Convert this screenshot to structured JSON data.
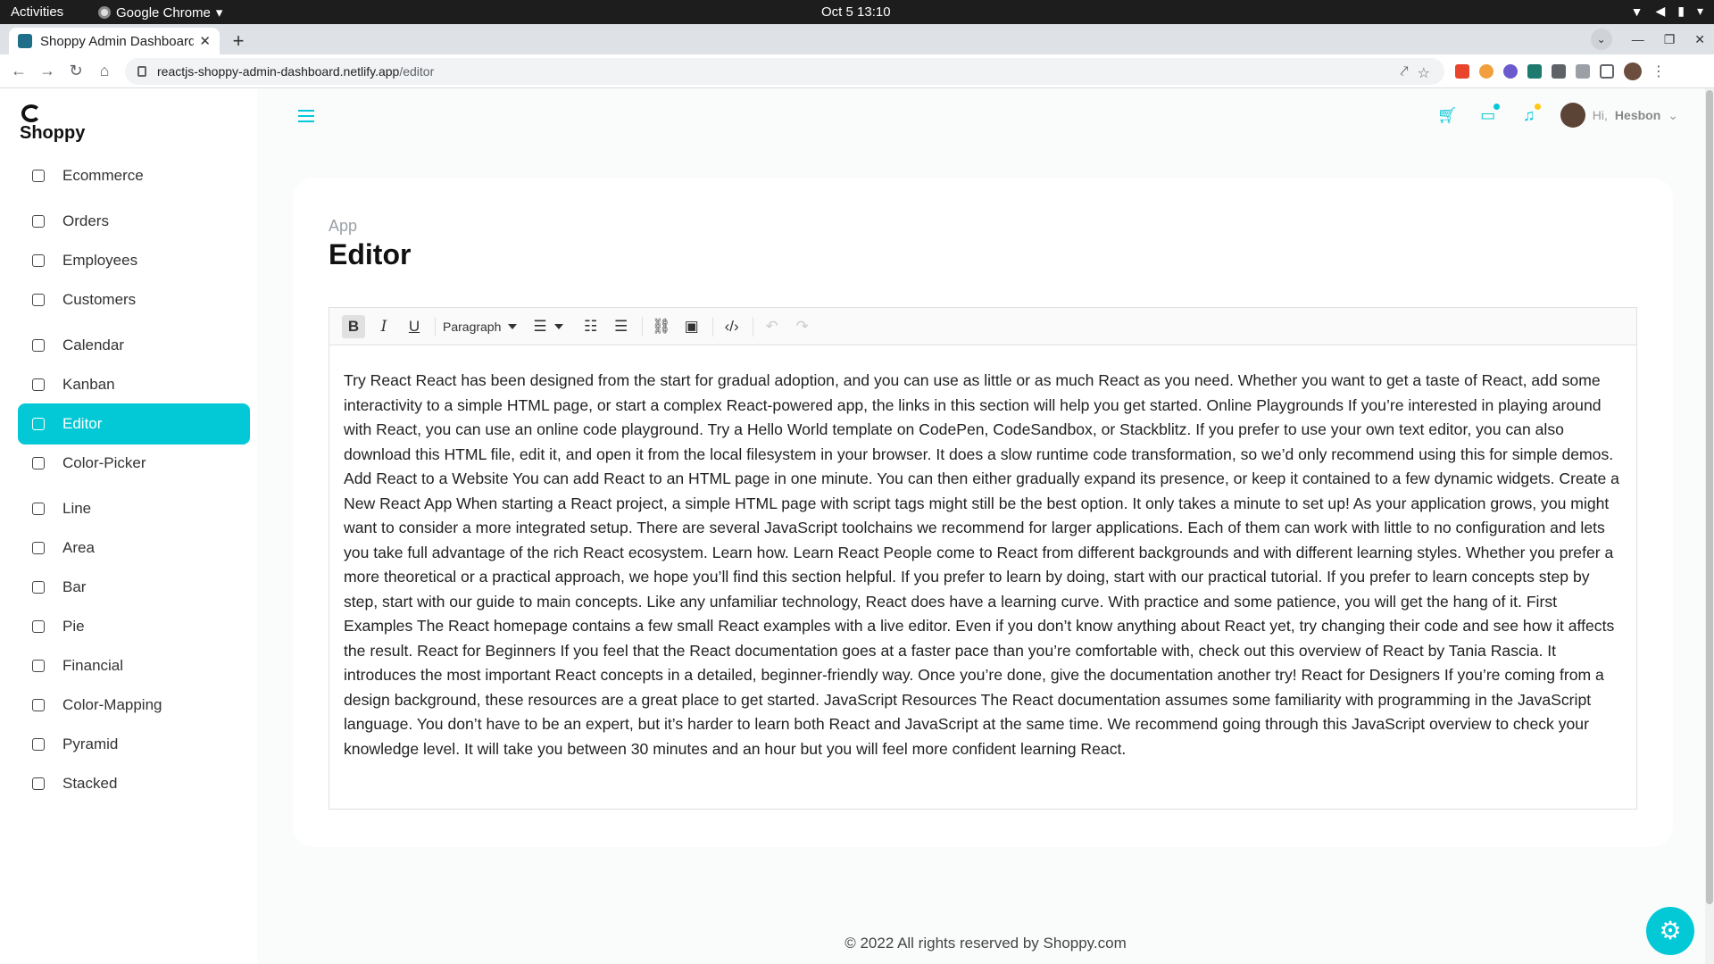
{
  "os_bar": {
    "activities": "Activities",
    "app_menu": "Google Chrome",
    "clock": "Oct 5  13:10"
  },
  "browser": {
    "tab_title": "Shoppy Admin Dashboard",
    "url_host": "reactjs-shoppy-admin-dashboard.netlify.app",
    "url_path": "/editor"
  },
  "brand": {
    "name": "Shoppy"
  },
  "sidebar": {
    "items": [
      {
        "label": "Ecommerce",
        "icon": "bag-icon"
      },
      {
        "label": "Orders",
        "icon": "cart-icon"
      },
      {
        "label": "Employees",
        "icon": "people-icon"
      },
      {
        "label": "Customers",
        "icon": "customers-icon"
      },
      {
        "label": "Calendar",
        "icon": "calendar-icon"
      },
      {
        "label": "Kanban",
        "icon": "kanban-icon"
      },
      {
        "label": "Editor",
        "icon": "edit-icon",
        "active": true
      },
      {
        "label": "Color-Picker",
        "icon": "paint-bucket-icon"
      },
      {
        "label": "Line",
        "icon": "line-chart-icon"
      },
      {
        "label": "Area",
        "icon": "area-chart-icon"
      },
      {
        "label": "Bar",
        "icon": "bar-chart-icon"
      },
      {
        "label": "Pie",
        "icon": "pie-chart-icon"
      },
      {
        "label": "Financial",
        "icon": "financial-icon"
      },
      {
        "label": "Color-Mapping",
        "icon": "color-mapping-icon"
      },
      {
        "label": "Pyramid",
        "icon": "pyramid-icon"
      },
      {
        "label": "Stacked",
        "icon": "stacked-chart-icon"
      }
    ]
  },
  "header": {
    "greeting": "Hi,",
    "user_name": "Hesbon"
  },
  "page": {
    "breadcrumb": "App",
    "title": "Editor"
  },
  "editor": {
    "block_format": "Paragraph",
    "content": "Try React React has been designed from the start for gradual adoption, and you can use as little or as much React as you need. Whether you want to get a taste of React, add some interactivity to a simple HTML page, or start a complex React-powered app, the links in this section will help you get started. Online Playgrounds If you’re interested in playing around with React, you can use an online code playground. Try a Hello World template on CodePen, CodeSandbox, or Stackblitz. If you prefer to use your own text editor, you can also download this HTML file, edit it, and open it from the local filesystem in your browser. It does a slow runtime code transformation, so we’d only recommend using this for simple demos. Add React to a Website You can add React to an HTML page in one minute. You can then either gradually expand its presence, or keep it contained to a few dynamic widgets. Create a New React App When starting a React project, a simple HTML page with script tags might still be the best option. It only takes a minute to set up! As your application grows, you might want to consider a more integrated setup. There are several JavaScript toolchains we recommend for larger applications. Each of them can work with little to no configuration and lets you take full advantage of the rich React ecosystem. Learn how. Learn React People come to React from different backgrounds and with different learning styles. Whether you prefer a more theoretical or a practical approach, we hope you’ll find this section helpful. If you prefer to learn by doing, start with our practical tutorial. If you prefer to learn concepts step by step, start with our guide to main concepts. Like any unfamiliar technology, React does have a learning curve. With practice and some patience, you will get the hang of it. First Examples The React homepage contains a few small React examples with a live editor. Even if you don’t know anything about React yet, try changing their code and see how it affects the result. React for Beginners If you feel that the React documentation goes at a faster pace than you’re comfortable with, check out this overview of React by Tania Rascia. It introduces the most important React concepts in a detailed, beginner-friendly way. Once you’re done, give the documentation another try! React for Designers If you’re coming from a design background, these resources are a great place to get started. JavaScript Resources The React documentation assumes some familiarity with programming in the JavaScript language. You don’t have to be an expert, but it’s harder to learn both React and JavaScript at the same time. We recommend going through this JavaScript overview to check your knowledge level. It will take you between 30 minutes and an hour but you will feel more confident learning React."
  },
  "footer": {
    "text": "© 2022 All rights reserved by Shoppy.com"
  },
  "colors": {
    "accent": "#03c9d7",
    "chat_dot": "#03c9d7",
    "notification_dot": "#fec90f"
  }
}
